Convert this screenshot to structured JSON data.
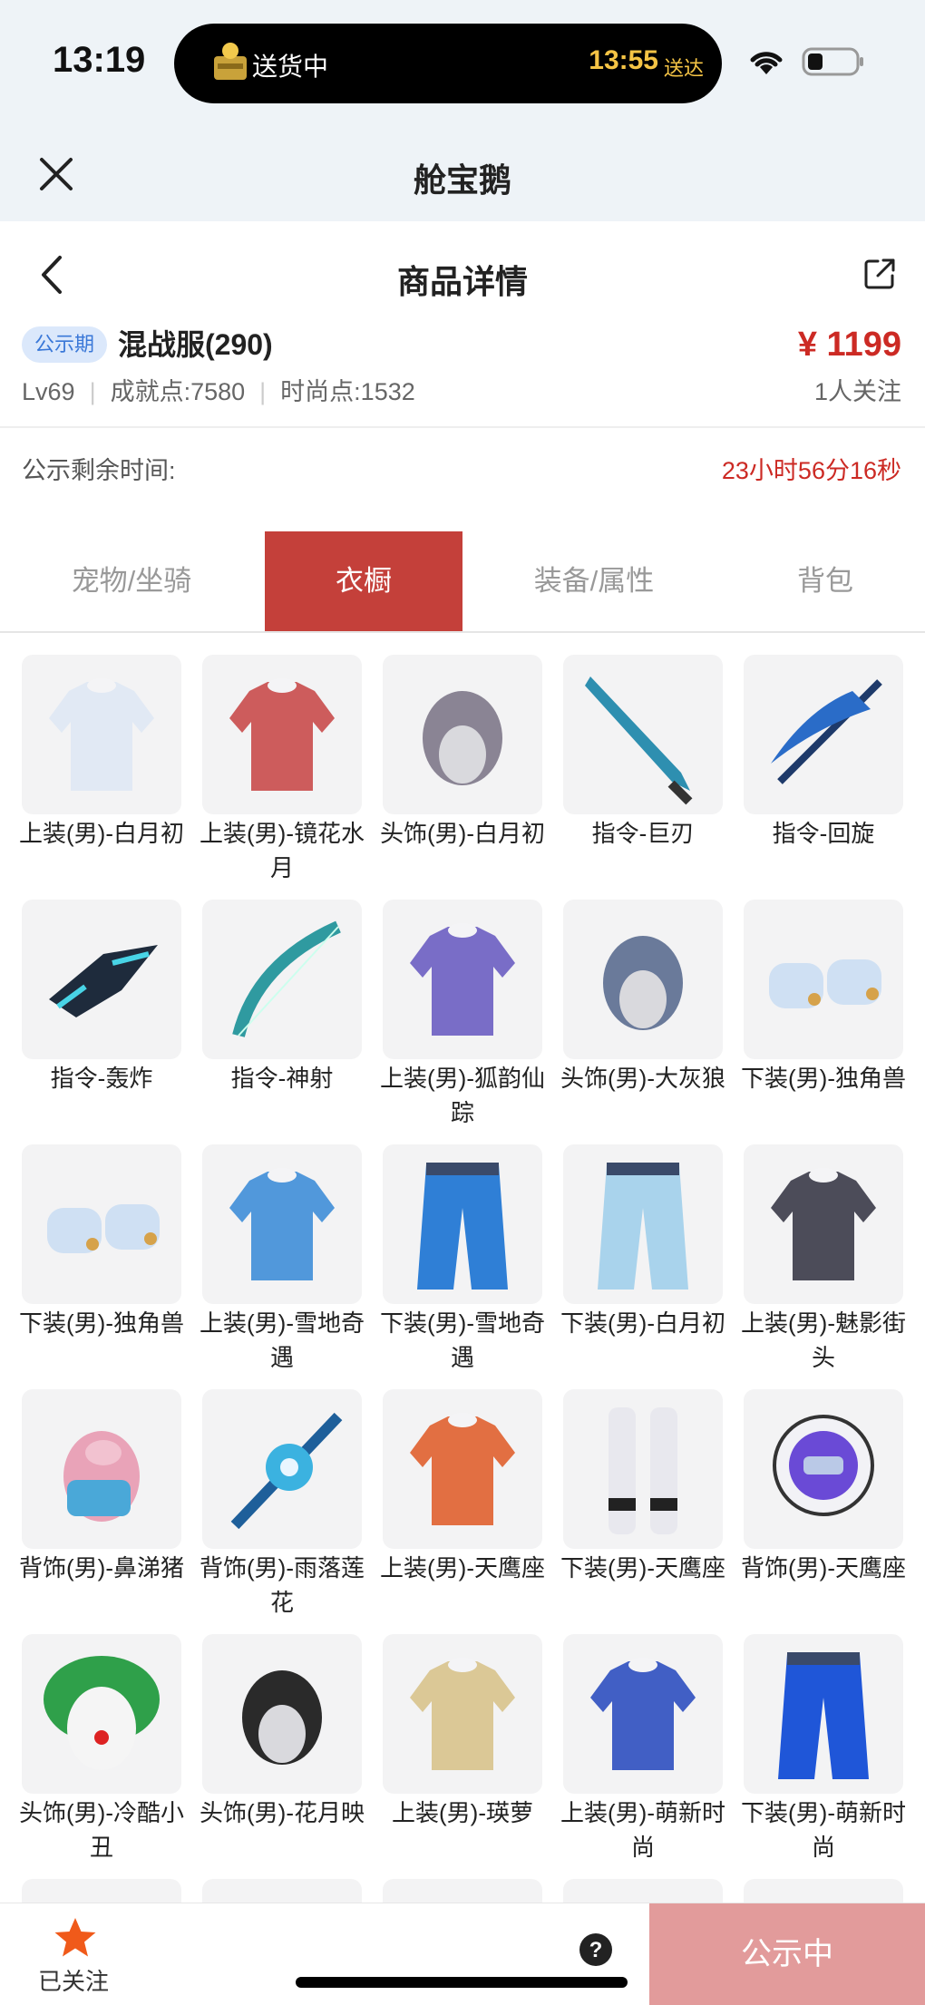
{
  "status_bar": {
    "time": "13:19",
    "island_text": "送货中",
    "island_time": "13:55",
    "island_suffix": "送达"
  },
  "app": {
    "title": "舱宝鹅"
  },
  "header": {
    "title": "商品详情"
  },
  "product": {
    "badge": "公示期",
    "name": "混战服(290)",
    "price": "¥ 1199",
    "level": "Lv69",
    "achievement": "成就点:7580",
    "fashion": "时尚点:1532",
    "followers": "1人关注"
  },
  "countdown": {
    "label": "公示剩余时间:",
    "value": "23小时56分16秒"
  },
  "tabs": [
    {
      "label": "宠物/坐骑",
      "active": false
    },
    {
      "label": "衣橱",
      "active": true
    },
    {
      "label": "装备/属性",
      "active": false
    },
    {
      "label": "背包",
      "active": false
    }
  ],
  "items": [
    {
      "label": "上装(男)-白月初",
      "icon": "top-icon",
      "color": "#dfe8f4"
    },
    {
      "label": "上装(男)-镜花水月",
      "icon": "top-icon",
      "color": "#c94b4b"
    },
    {
      "label": "头饰(男)-白月初",
      "icon": "head-icon",
      "color": "#8a8494"
    },
    {
      "label": "指令-巨刃",
      "icon": "blade-icon",
      "color": "#2e8fb0"
    },
    {
      "label": "指令-回旋",
      "icon": "scythe-icon",
      "color": "#2a6cc8"
    },
    {
      "label": "指令-轰炸",
      "icon": "drone-icon",
      "color": "#1e2b3c"
    },
    {
      "label": "指令-神射",
      "icon": "bow-icon",
      "color": "#2f9aa0"
    },
    {
      "label": "上装(男)-狐韵仙踪",
      "icon": "top-icon",
      "color": "#6b5ec2"
    },
    {
      "label": "头饰(男)-大灰狼",
      "icon": "head-icon",
      "color": "#6a7a9a"
    },
    {
      "label": "下装(男)-独角兽",
      "icon": "boots-icon",
      "color": "#cfe0f3"
    },
    {
      "label": "下装(男)-独角兽",
      "icon": "boots-icon",
      "color": "#cfe0f3"
    },
    {
      "label": "上装(男)-雪地奇遇",
      "icon": "top-icon",
      "color": "#3f8ed8"
    },
    {
      "label": "下装(男)-雪地奇遇",
      "icon": "pants-icon",
      "color": "#2f7fd6"
    },
    {
      "label": "下装(男)-白月初",
      "icon": "pants-icon",
      "color": "#a9d3ec"
    },
    {
      "label": "上装(男)-魅影街头",
      "icon": "top-icon",
      "color": "#3a3a48"
    },
    {
      "label": "背饰(男)-鼻涕猪",
      "icon": "pig-icon",
      "color": "#e9a3b8"
    },
    {
      "label": "背饰(男)-雨落莲花",
      "icon": "lotus-icon",
      "color": "#3bb2e0"
    },
    {
      "label": "上装(男)-天鹰座",
      "icon": "top-icon",
      "color": "#e0612f"
    },
    {
      "label": "下装(男)-天鹰座",
      "icon": "legs-icon",
      "color": "#e8e8ee"
    },
    {
      "label": "背饰(男)-天鹰座",
      "icon": "orb-icon",
      "color": "#6a4ad6"
    },
    {
      "label": "头饰(男)-冷酷小丑",
      "icon": "clown-icon",
      "color": "#2fa04a"
    },
    {
      "label": "头饰(男)-花月映",
      "icon": "head-icon",
      "color": "#2a2a2a"
    },
    {
      "label": "上装(男)-瑛萝",
      "icon": "top-icon",
      "color": "#d8c38c"
    },
    {
      "label": "上装(男)-萌新时尚",
      "icon": "top-icon",
      "color": "#2d4fc0"
    },
    {
      "label": "下装(男)-萌新时尚",
      "icon": "pants-icon",
      "color": "#1f56d8"
    }
  ],
  "bottom_bar": {
    "follow_label": "已关注",
    "status_label": "公示中"
  },
  "colors": {
    "accent": "#c4403a",
    "price": "#cc2a24",
    "status_button": "#e29b9b",
    "star": "#f05a1a"
  }
}
